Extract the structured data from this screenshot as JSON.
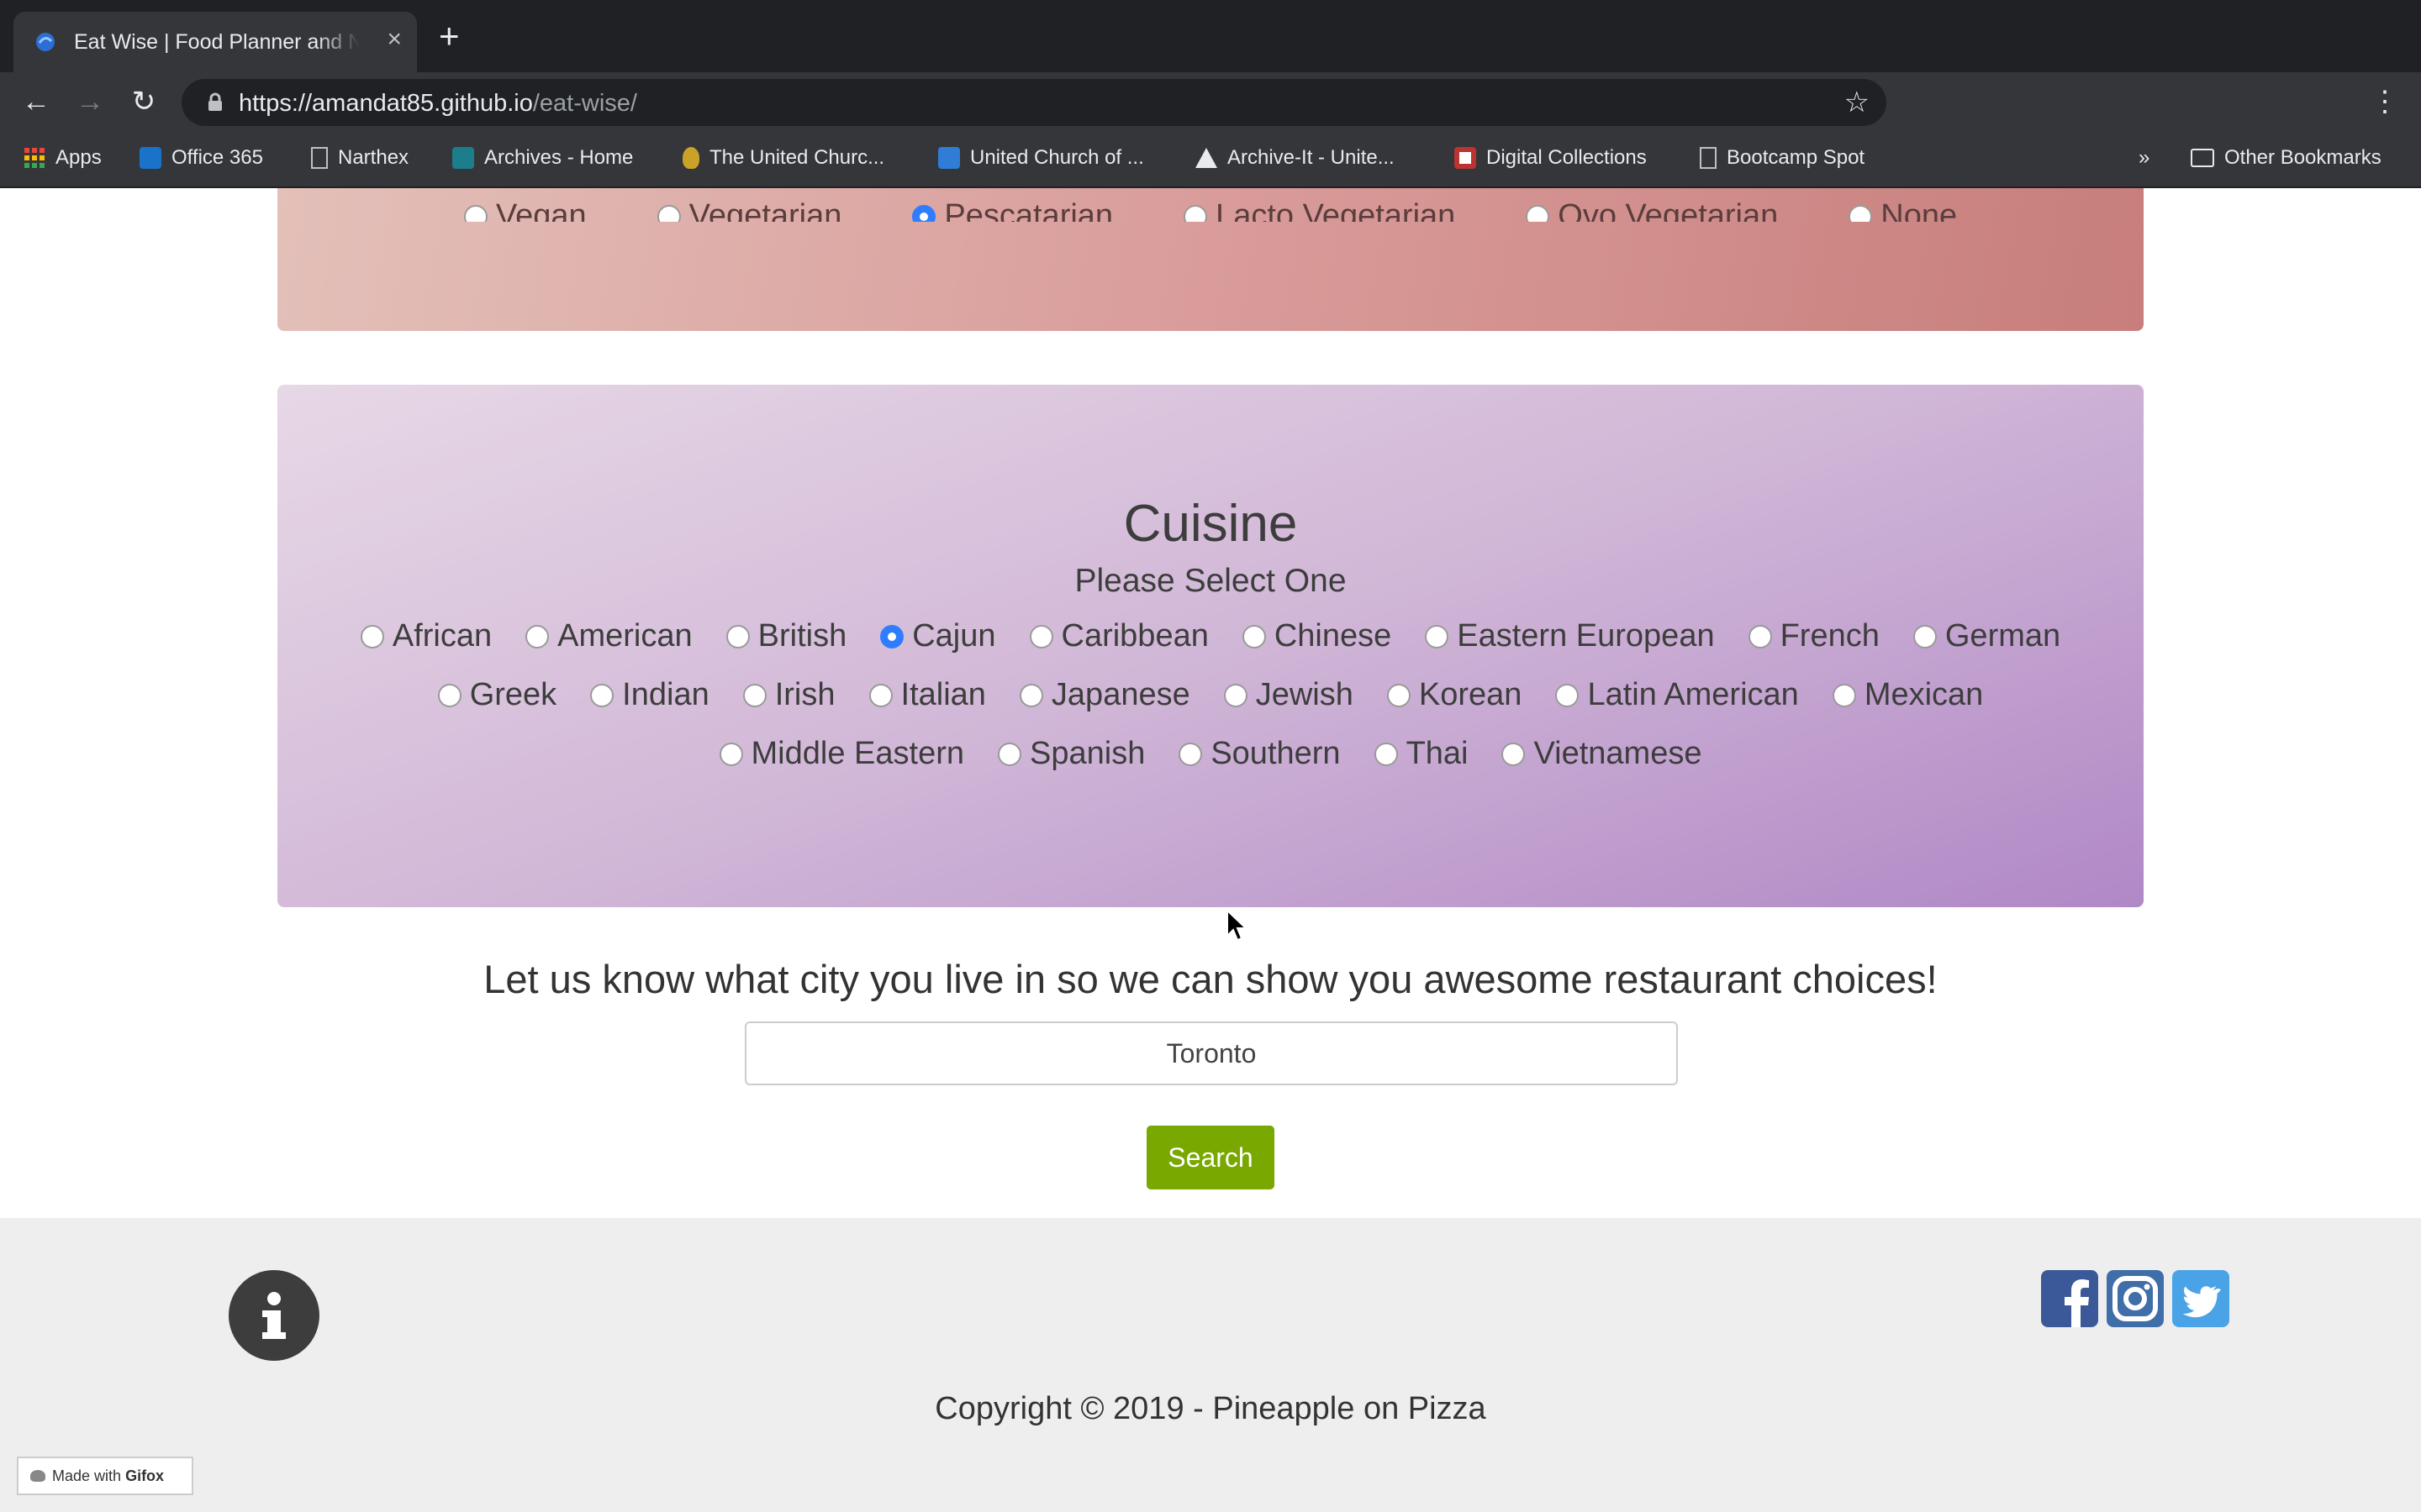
{
  "browser": {
    "tab_title": "Eat Wise | Food Planner and Nutrition",
    "tab_close": "×",
    "new_tab": "+",
    "url_host": "https://amandat85.github.io",
    "url_path": "/eat-wise/",
    "bookmarks": [
      {
        "label": "Apps",
        "icon": "apps-grid-icon"
      },
      {
        "label": "Office 365",
        "icon": "outlook-icon"
      },
      {
        "label": "Narthex",
        "icon": "page-icon"
      },
      {
        "label": "Archives - Home",
        "icon": "sharepoint-icon"
      },
      {
        "label": "The United Churc...",
        "icon": "church-crest-icon"
      },
      {
        "label": "United Church of ...",
        "icon": "united-church-icon"
      },
      {
        "label": "Archive-It - Unite...",
        "icon": "archive-it-icon"
      },
      {
        "label": "Digital Collections",
        "icon": "crest-icon"
      },
      {
        "label": "Bootcamp Spot",
        "icon": "page-icon"
      }
    ],
    "bookmarks_overflow": "»",
    "other_bookmarks": "Other Bookmarks"
  },
  "diet": {
    "options": [
      "Vegan",
      "Vegetarian",
      "Pescatarian",
      "Lacto Vegetarian",
      "Ovo Vegetarian",
      "None"
    ],
    "selected": "Pescatarian"
  },
  "cuisine": {
    "title": "Cuisine",
    "subtitle": "Please Select One",
    "rows": [
      [
        "African",
        "American",
        "British",
        "Cajun",
        "Caribbean",
        "Chinese",
        "Eastern European",
        "French",
        "German"
      ],
      [
        "Greek",
        "Indian",
        "Irish",
        "Italian",
        "Japanese",
        "Jewish",
        "Korean",
        "Latin American",
        "Mexican"
      ],
      [
        "Middle Eastern",
        "Spanish",
        "Southern",
        "Thai",
        "Vietnamese"
      ]
    ],
    "selected": "Cajun"
  },
  "city": {
    "prompt": "Let us know what city you live in so we can show you awesome restaurant choices!",
    "value": "Toronto",
    "search_label": "Search"
  },
  "footer": {
    "copyright": "Copyright © 2019 - Pineapple on Pizza",
    "social": [
      "facebook-icon",
      "instagram-icon",
      "twitter-icon"
    ]
  },
  "overlay": {
    "gifox_prefix": "Made with",
    "gifox_brand": "Gifox"
  },
  "colors": {
    "search_button": "#79a800",
    "radio_selected": "#2f7dff",
    "facebook": "#3b5998",
    "instagram": "#3f6ea8",
    "twitter": "#4aa3e6"
  }
}
